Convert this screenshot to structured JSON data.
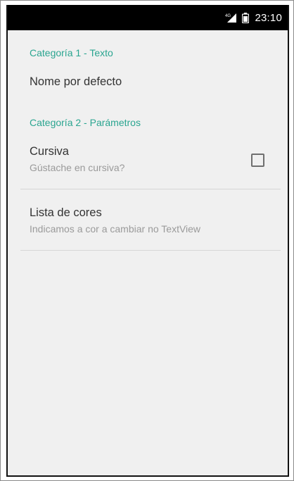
{
  "status_bar": {
    "time": "23:10",
    "icons": [
      "signal-icon",
      "battery-icon"
    ]
  },
  "preferences": {
    "category1_title": "Categoría 1 - Texto",
    "nome_title": "Nome por defecto",
    "category2_title": "Categoría 2 - Parámetros",
    "cursiva_title": "Cursiva",
    "cursiva_summary": "Gústache en cursiva?",
    "cursiva_checked": false,
    "lista_title": "Lista de cores",
    "lista_summary": "Indicamos a cor a cambiar no TextView"
  },
  "colors": {
    "category_accent": "#2aa590",
    "status_bar": "#000000",
    "background": "#f0f0f0"
  }
}
